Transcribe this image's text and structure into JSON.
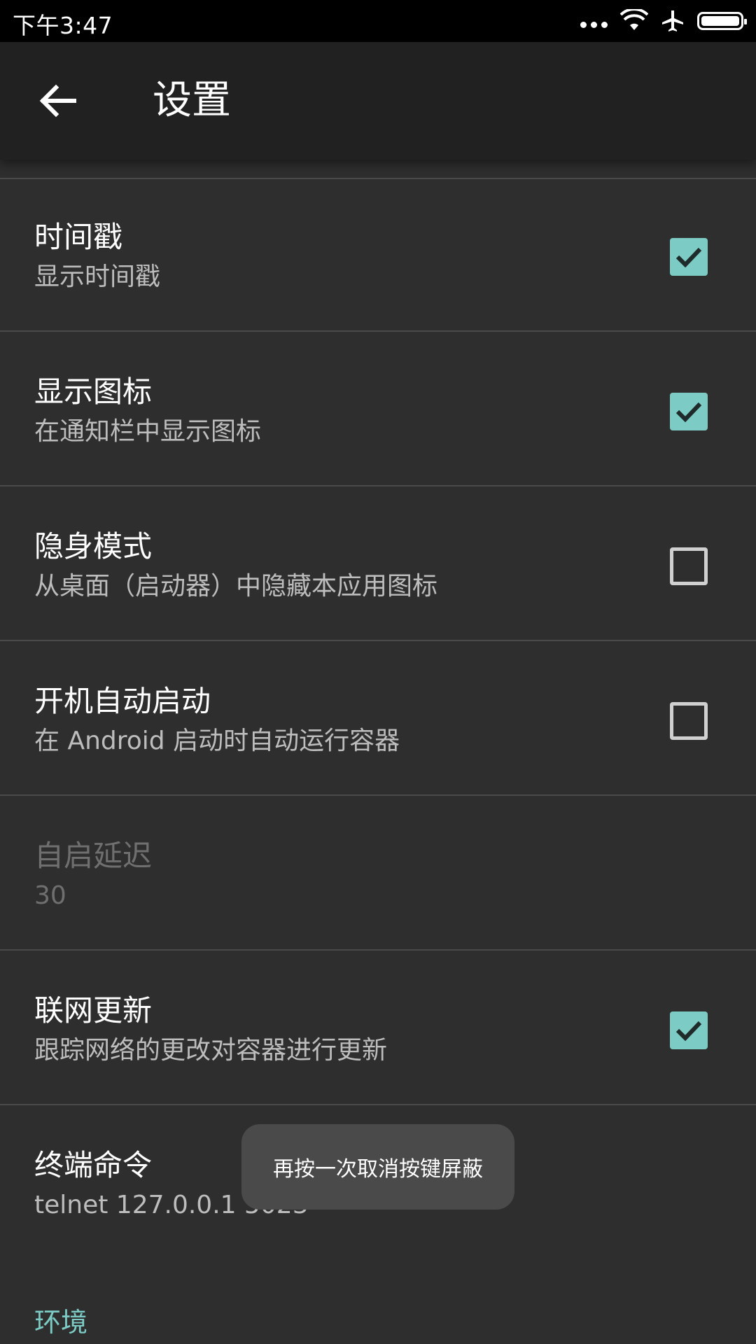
{
  "status": {
    "time": "下午3:47"
  },
  "appbar": {
    "title": "设置"
  },
  "settings": [
    {
      "title": "时间戳",
      "summary": "显示时间戳",
      "checkbox": true,
      "checked": true,
      "enabled": true
    },
    {
      "title": "显示图标",
      "summary": "在通知栏中显示图标",
      "checkbox": true,
      "checked": true,
      "enabled": true
    },
    {
      "title": "隐身模式",
      "summary": "从桌面（启动器）中隐藏本应用图标",
      "checkbox": true,
      "checked": false,
      "enabled": true
    },
    {
      "title": "开机自动启动",
      "summary": "在 Android 启动时自动运行容器",
      "checkbox": true,
      "checked": false,
      "enabled": true
    },
    {
      "title": "自启延迟",
      "summary": "30",
      "checkbox": false,
      "enabled": false
    },
    {
      "title": "联网更新",
      "summary": "跟踪网络的更改对容器进行更新",
      "checkbox": true,
      "checked": true,
      "enabled": true
    },
    {
      "title": "终端命令",
      "summary": "telnet 127.0.0.1 5023",
      "checkbox": false,
      "enabled": true
    }
  ],
  "section_header": "环境",
  "toast": "再按一次取消按键屏蔽",
  "colors": {
    "accent": "#7ccbc4",
    "background": "#2e2e2e",
    "appbar": "#212121"
  }
}
